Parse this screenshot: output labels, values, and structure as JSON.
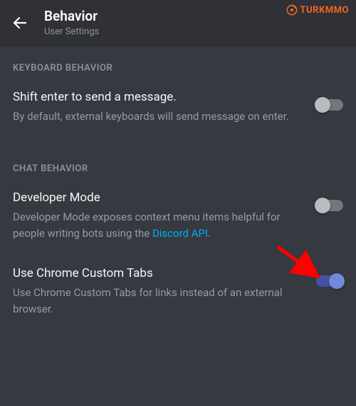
{
  "brand": {
    "name": "TURKMMO"
  },
  "header": {
    "title": "Behavior",
    "subtitle": "User Settings"
  },
  "sections": {
    "keyboard": {
      "label": "KEYBOARD BEHAVIOR",
      "shiftEnter": {
        "title": "Shift enter to send a message.",
        "desc": "By default, external keyboards will send message on enter.",
        "enabled": false
      }
    },
    "chat": {
      "label": "CHAT BEHAVIOR",
      "developerMode": {
        "title": "Developer Mode",
        "descPre": "Developer Mode exposes context menu items helpful for people writing bots using the ",
        "link": "Discord API",
        "descPost": ".",
        "enabled": false
      },
      "chromeTabs": {
        "title": "Use Chrome Custom Tabs",
        "desc": "Use Chrome Custom Tabs for links instead of an external browser.",
        "enabled": true
      }
    }
  }
}
